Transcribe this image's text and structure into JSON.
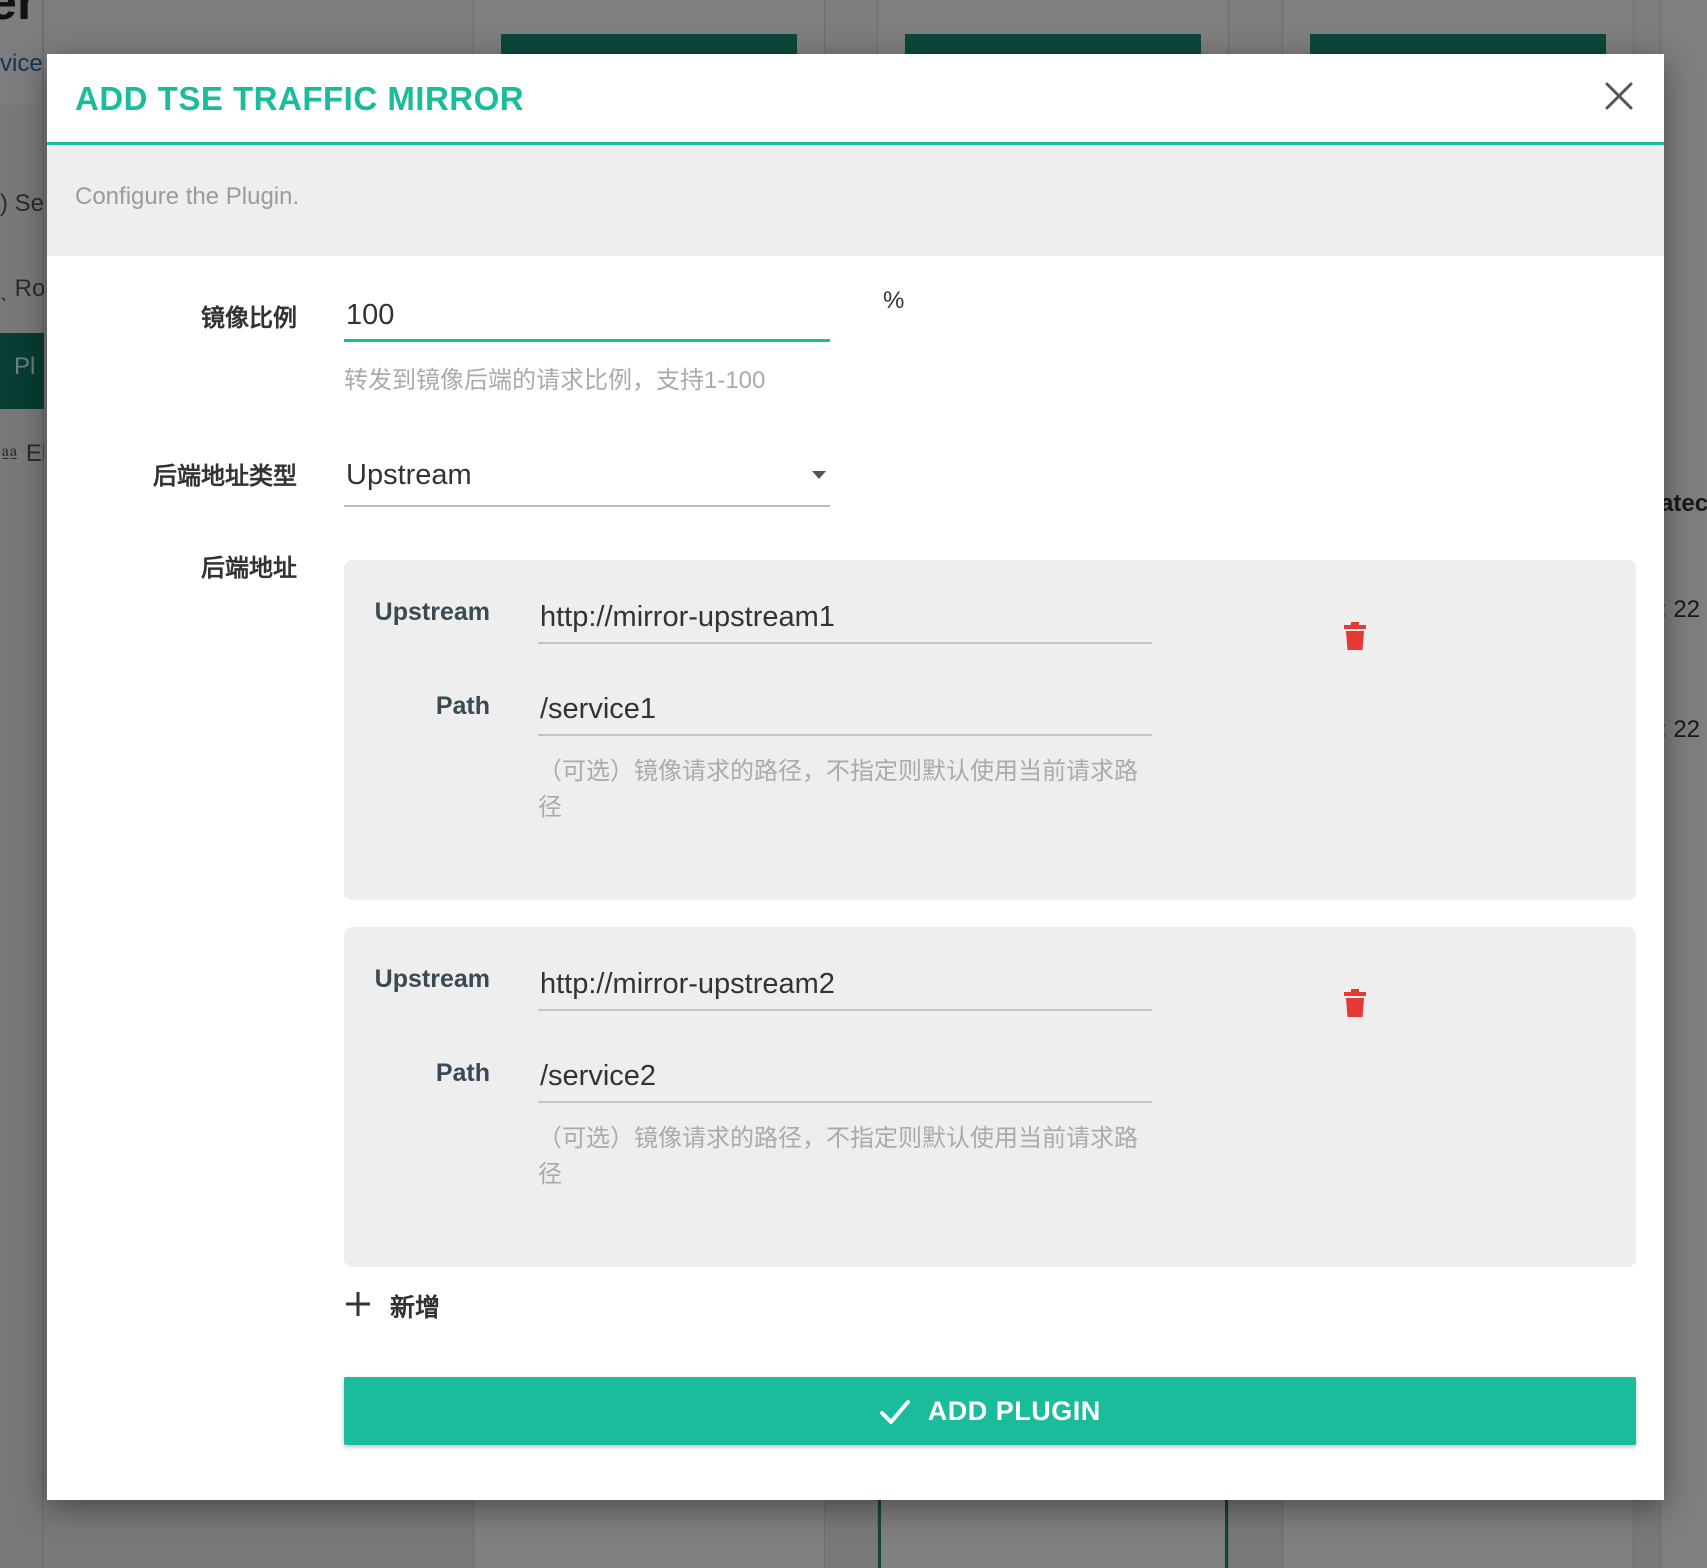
{
  "background": {
    "page_title_fragment": "er",
    "subtitle_fragment": "vice",
    "sidebar_items": [
      {
        "label": ") Se"
      },
      {
        "label": "ˎ Ro"
      },
      {
        "label": "Pl"
      },
      {
        "label": "⎂ Eli"
      }
    ],
    "right_column": {
      "header_fragment": "atec",
      "row1_fragment": ": 22",
      "row2_fragment": ": 22"
    }
  },
  "modal": {
    "title": "ADD TSE TRAFFIC MIRROR",
    "close_icon": "close-icon",
    "description": "Configure the Plugin.",
    "ratio": {
      "label": "镜像比例",
      "value": "100",
      "unit": "%",
      "hint": "转发到镜像后端的请求比例，支持1-100"
    },
    "backend_type": {
      "label": "后端地址类型",
      "selected": "Upstream"
    },
    "backend_address": {
      "label": "后端地址",
      "entries": [
        {
          "upstream_label": "Upstream",
          "upstream_value": "http://mirror-upstream1",
          "path_label": "Path",
          "path_value": "/service1",
          "path_hint": "（可选）镜像请求的路径，不指定则默认使用当前请求路径"
        },
        {
          "upstream_label": "Upstream",
          "upstream_value": "http://mirror-upstream2",
          "path_label": "Path",
          "path_value": "/service2",
          "path_hint": "（可选）镜像请求的路径，不指定则默认使用当前请求路径"
        }
      ],
      "add_label": "新增"
    },
    "submit_label": "ADD PLUGIN",
    "colors": {
      "accent": "#1bbc9b",
      "danger": "#e53935",
      "panel": "#eeeeee"
    }
  }
}
